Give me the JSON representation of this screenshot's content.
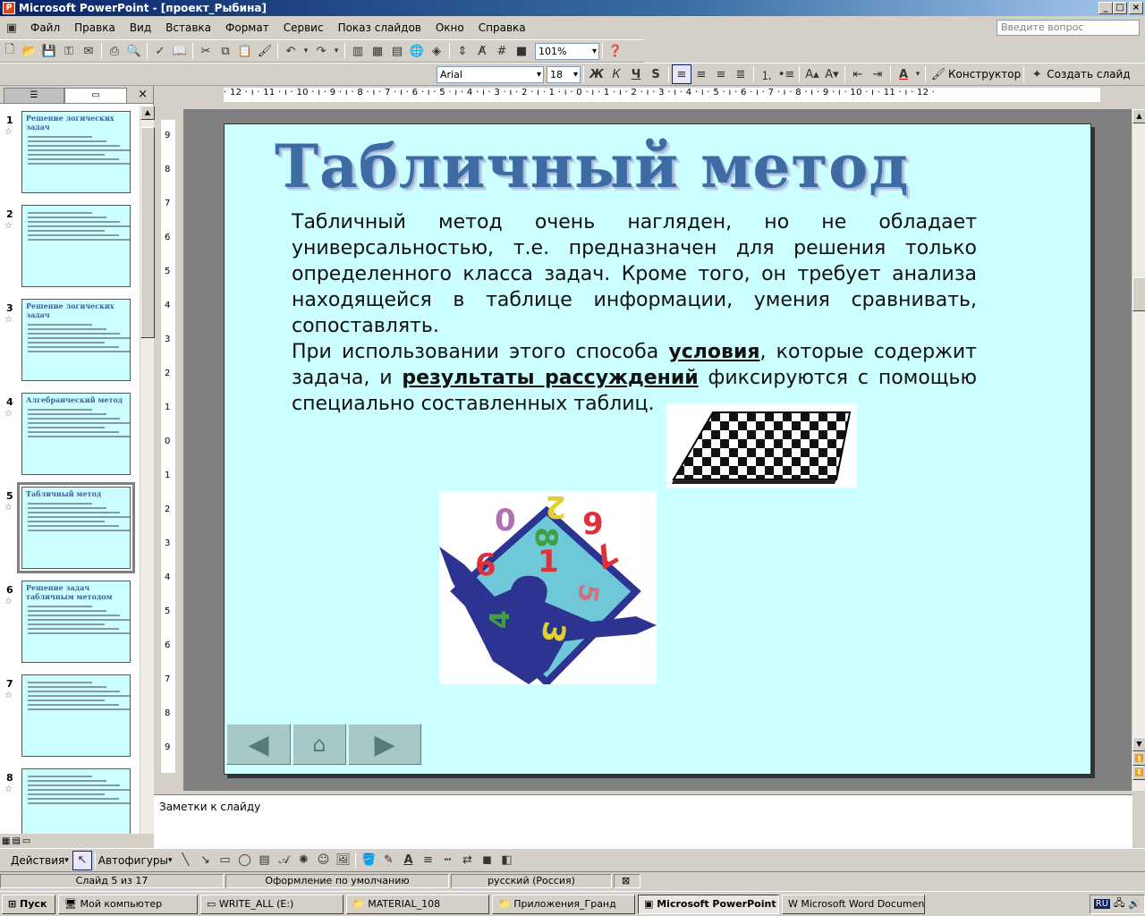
{
  "window": {
    "title": "Microsoft PowerPoint - [проект_Рыбина]",
    "app_icon": "powerpoint-icon"
  },
  "menu": {
    "items": [
      "Файл",
      "Правка",
      "Вид",
      "Вставка",
      "Формат",
      "Сервис",
      "Показ слайдов",
      "Окно",
      "Справка"
    ],
    "ask_placeholder": "Введите вопрос"
  },
  "toolbar_standard": {
    "zoom": "101%"
  },
  "toolbar_format": {
    "font": "Arial",
    "size": "18",
    "bold": "Ж",
    "italic": "К",
    "underline": "Ч",
    "shadow": "S",
    "designer": "Конструктор",
    "new_slide": "Создать слайд"
  },
  "ruler": {
    "h_ticks": "· 12 · ı · 11 · ı · 10 · ı · 9 · ı · 8 · ı · 7 · ı · 6 · ı · 5 · ı · 4 · ı · 3 · ı · 2 · ı · 1 · ı · 0 · ı · 1 · ı · 2 · ı · 3 · ı · 4 · ı · 5 · ı · 6 · ı · 7 · ı · 8 · ı · 9 · ı · 10 · ı · 11 · ı · 12 ·"
  },
  "slides_panel": {
    "thumbnails": [
      {
        "num": "1",
        "title": "Решение логических задач"
      },
      {
        "num": "2",
        "title": ""
      },
      {
        "num": "3",
        "title": "Решение логических задач"
      },
      {
        "num": "4",
        "title": "Алгебраический метод"
      },
      {
        "num": "5",
        "title": "Табличный метод"
      },
      {
        "num": "6",
        "title": "Решение задач табличным методом"
      },
      {
        "num": "7",
        "title": ""
      },
      {
        "num": "8",
        "title": ""
      }
    ]
  },
  "slide": {
    "title": "Табличный метод",
    "para1": "Табличный метод очень нагляден, но не обладает универсальностью, т.е. предназначен для решения только определенного класса задач. Кроме того, он требует анализа находящейся в таблице информации, умения сравнивать, сопоставлять.",
    "para2_a": "При использовании этого способа ",
    "para2_b": "условия",
    "para2_c": ", которые содержит задача, и ",
    "para2_d": "результаты рассуждений",
    "para2_e": " фиксируются с помощью специально составленных таблиц.",
    "numbers": [
      "0",
      "2",
      "9",
      "8",
      "1",
      "6",
      "7",
      "5",
      "4",
      "3"
    ]
  },
  "notes": {
    "placeholder": "Заметки к слайду"
  },
  "draw_toolbar": {
    "actions": "Действия",
    "autoshapes": "Автофигуры"
  },
  "status": {
    "slide_of": "Слайд 5 из 17",
    "design": "Оформление по умолчанию",
    "language": "русский (Россия)"
  },
  "taskbar": {
    "start": "Пуск",
    "tasks": [
      "Мой компьютер",
      "WRITE_ALL (E:)",
      "MATERIAL_108",
      "Приложения_Гранд",
      "Microsoft PowerPoint ...",
      "Microsoft Word Documen..."
    ],
    "lang": "RU"
  },
  "colors": {
    "slide_bg": "#ccffff",
    "title": "#3e6ba3",
    "titlebar": "#0a246a"
  }
}
